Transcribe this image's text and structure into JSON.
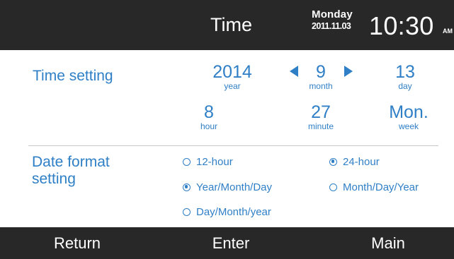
{
  "header": {
    "title": "Time",
    "weekday": "Monday",
    "date": "2011.11.03",
    "clock": "10:30",
    "ampm": "AM"
  },
  "time_setting": {
    "label": "Time setting",
    "year": {
      "value": "2014",
      "unit": "year"
    },
    "month": {
      "value": "9",
      "unit": "month"
    },
    "day": {
      "value": "13",
      "unit": "day"
    },
    "hour": {
      "value": "8",
      "unit": "hour"
    },
    "minute": {
      "value": "27",
      "unit": "minute"
    },
    "week": {
      "value": "Mon.",
      "unit": "week"
    }
  },
  "date_format": {
    "label_line1": "Date format",
    "label_line2": "setting",
    "options": [
      {
        "label": "12-hour",
        "checked": false
      },
      {
        "label": "24-hour",
        "checked": true
      },
      {
        "label": "Year/Month/Day",
        "checked": true
      },
      {
        "label": "Month/Day/Year",
        "checked": false
      },
      {
        "label": "Day/Month/year",
        "checked": false
      }
    ]
  },
  "footer": {
    "return_label": "Return",
    "enter_label": "Enter",
    "main_label": "Main"
  },
  "colors": {
    "accent": "#2f7fc6",
    "bar": "#282828",
    "divider": "#c9c9c9"
  }
}
